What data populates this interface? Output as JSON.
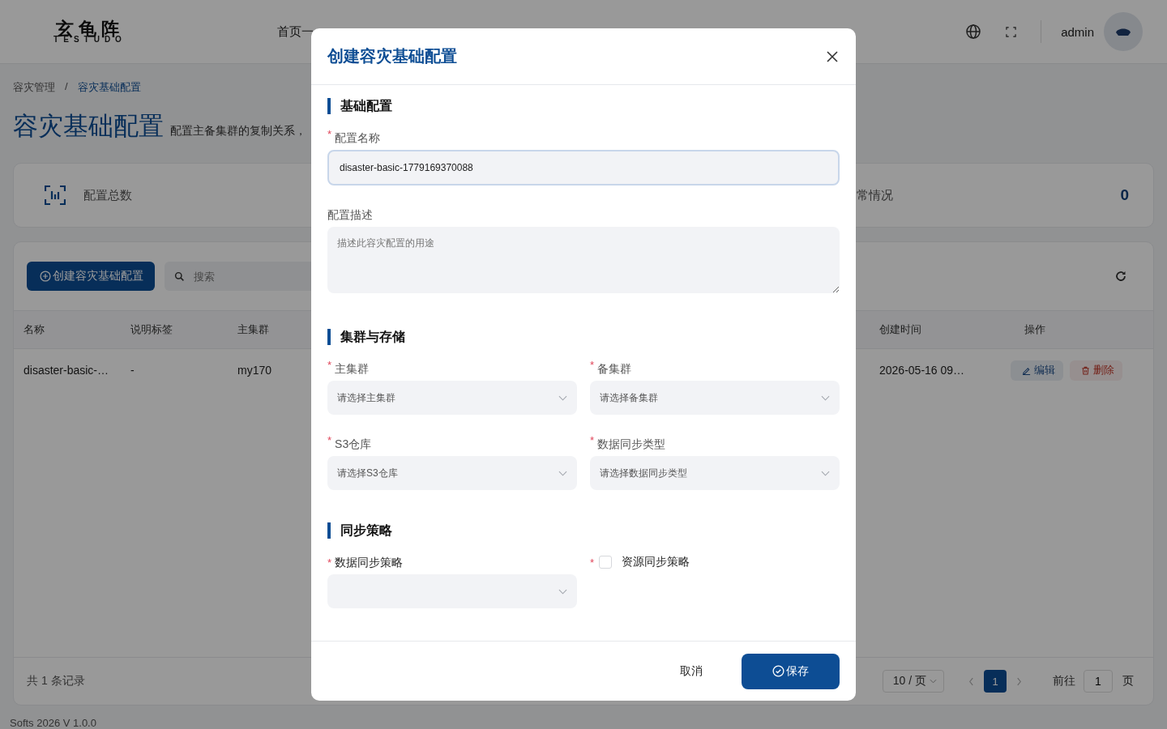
{
  "header": {
    "logo": "玄龟阵",
    "logo_sub": "TESTUDO",
    "nav": [
      {
        "label": "首页一"
      }
    ],
    "user": "admin"
  },
  "breadcrumb": [
    "容灾管理",
    "/",
    "容灾基础配置"
  ],
  "page": {
    "title": "容灾基础配置",
    "subtitle": "配置主备集群的复制关系，"
  },
  "stats": [
    {
      "label": "配置总数"
    },
    {
      "label": "常情况",
      "value": "0"
    }
  ],
  "toolbar": {
    "create_button": "创建容灾基础配置",
    "search_placeholder": "搜索"
  },
  "table": {
    "columns": [
      {
        "label": "名称",
        "kind": "name"
      },
      {
        "label": "说明标签",
        "kind": "tag"
      },
      {
        "label": "主集群",
        "kind": "primary"
      },
      {
        "label": "创建时间",
        "kind": "time"
      },
      {
        "label": "操作",
        "kind": "actions"
      }
    ],
    "rows": [
      {
        "cells": [
          "disaster-basic-…",
          "-",
          "my170",
          "2026-05-16 09…"
        ],
        "actions": [
          {
            "label": "编辑",
            "kind": "edit"
          },
          {
            "label": "删除",
            "kind": "delete"
          }
        ]
      }
    ]
  },
  "pagination": {
    "total": "共 1 条记录",
    "page_size": "10 / 页",
    "pages": [
      {
        "label": "1",
        "selected": true
      }
    ],
    "goto_label": "前往",
    "goto_value": "1",
    "goto_suffix": "页"
  },
  "footer": "Softs 2026 V 1.0.0",
  "dialog": {
    "title": "创建容灾基础配置",
    "sections": [
      {
        "title": "基础配置",
        "fields": [
          {
            "kind": "input",
            "label": "配置名称",
            "required_mark": "*",
            "value": "disaster-basic-1779169370088",
            "focused": true
          },
          {
            "kind": "textarea",
            "label": "配置描述",
            "placeholder": "描述此容灾配置的用途"
          }
        ]
      },
      {
        "title": "集群与存储",
        "fields": [
          {
            "kind": "select",
            "label": "主集群",
            "required_mark": "*",
            "placeholder": "请选择主集群"
          },
          {
            "kind": "select",
            "label": "备集群",
            "required_mark": "*",
            "placeholder": "请选择备集群"
          },
          {
            "kind": "select",
            "label": "S3仓库",
            "required_mark": "*",
            "placeholder": "请选择S3仓库"
          },
          {
            "kind": "select",
            "label": "数据同步类型",
            "required_mark": "*",
            "placeholder": "请选择数据同步类型"
          }
        ]
      },
      {
        "title": "同步策略",
        "fields": [
          {
            "kind": "select",
            "label": "数据同步策略",
            "required_mark": "*"
          },
          {
            "kind": "checkbox",
            "label": "资源同步策略",
            "required_mark": "*",
            "checked": false
          }
        ]
      }
    ],
    "cancel": "取消",
    "save": "保存"
  }
}
